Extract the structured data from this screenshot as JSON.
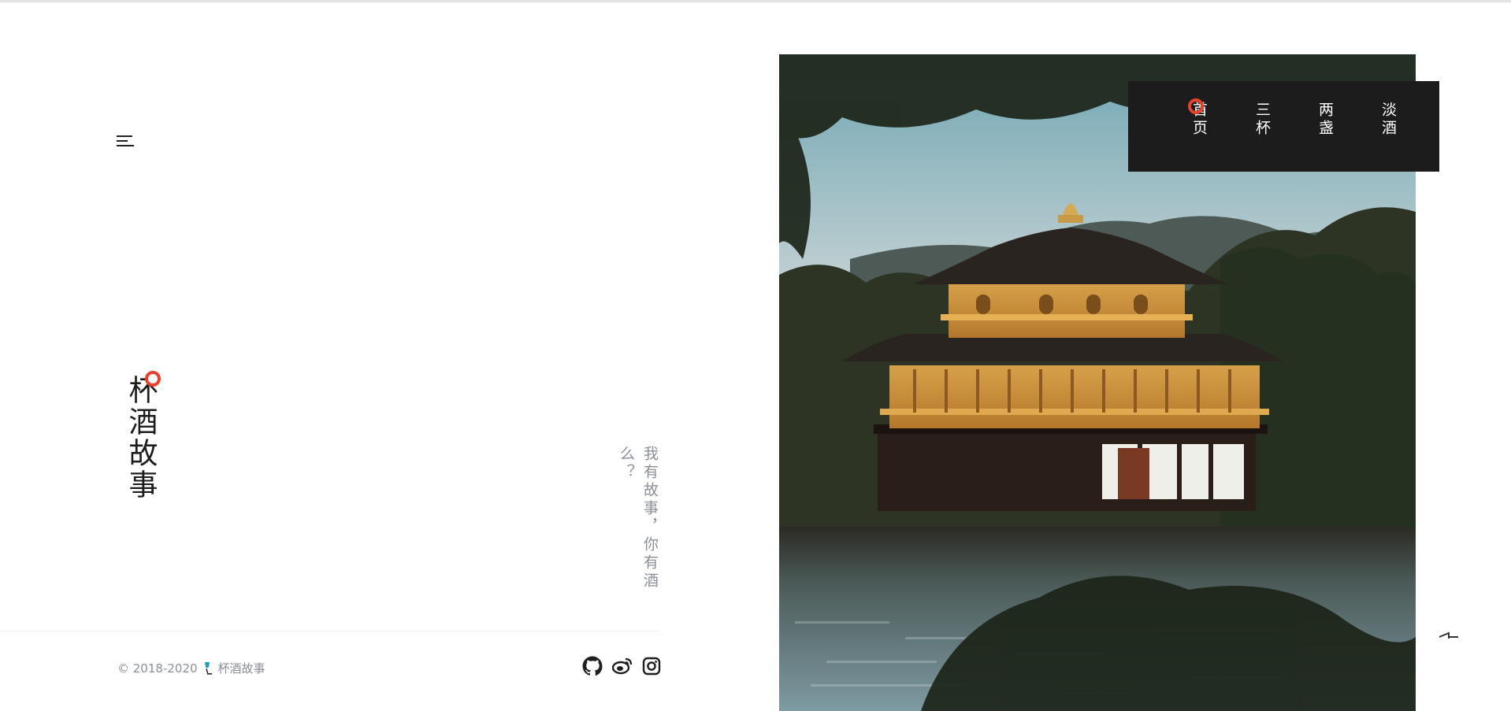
{
  "site": {
    "logo_text": "杯酒故事",
    "tagline": "我有故事，你有酒么？"
  },
  "nav": {
    "items": [
      {
        "label": "首页"
      },
      {
        "label": "三杯"
      },
      {
        "label": "两盏"
      },
      {
        "label": "淡酒"
      }
    ]
  },
  "footer": {
    "copyright_years": "© 2018-2020",
    "copyright_name": "杯酒故事",
    "social": [
      "github-icon",
      "weibo-icon",
      "instagram-icon"
    ]
  },
  "hero": {
    "image": "golden-pavilion-photo"
  },
  "pagination": {
    "current_icon": "page-arrow-icon"
  },
  "colors": {
    "accent": "#e8412c",
    "nav_bg": "#1c1c1c",
    "muted_text": "#8a8f98"
  }
}
